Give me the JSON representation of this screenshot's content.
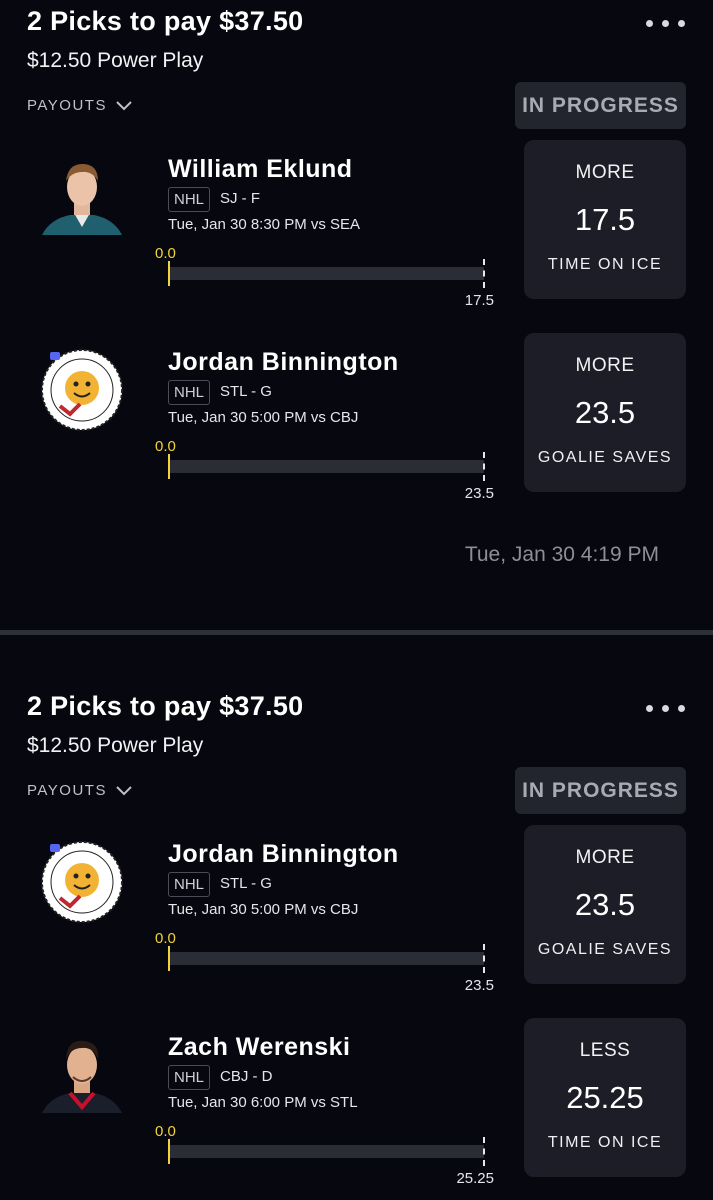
{
  "entries": [
    {
      "title": "2 Picks to pay $37.50",
      "subtitle": "$12.50 Power Play",
      "payouts_label": "PAYOUTS",
      "status": "IN PROGRESS",
      "timestamp": "Tue, Jan 30 4:19 PM",
      "picks": [
        {
          "player": "William Eklund",
          "league": "NHL",
          "team_pos": "SJ - F",
          "game": "Tue, Jan 30 8:30 PM  vs SEA",
          "current": "0.0",
          "target": "17.5",
          "direction": "MORE",
          "line": "17.5",
          "stat": "TIME ON ICE",
          "avatar": "player-headshot"
        },
        {
          "player": "Jordan Binnington",
          "league": "NHL",
          "team_pos": "STL - G",
          "game": "Tue, Jan 30 5:00 PM  vs CBJ",
          "current": "0.0",
          "target": "23.5",
          "direction": "MORE",
          "line": "23.5",
          "stat": "GOALIE SAVES",
          "avatar": "discord-voted-badge"
        }
      ]
    },
    {
      "title": "2 Picks to pay $37.50",
      "subtitle": "$12.50 Power Play",
      "payouts_label": "PAYOUTS",
      "status": "IN PROGRESS",
      "picks": [
        {
          "player": "Jordan Binnington",
          "league": "NHL",
          "team_pos": "STL - G",
          "game": "Tue, Jan 30 5:00 PM  vs CBJ",
          "current": "0.0",
          "target": "23.5",
          "direction": "MORE",
          "line": "23.5",
          "stat": "GOALIE SAVES",
          "avatar": "discord-voted-badge"
        },
        {
          "player": "Zach Werenski",
          "league": "NHL",
          "team_pos": "CBJ - D",
          "game": "Tue, Jan 30 6:00 PM  vs STL",
          "current": "0.0",
          "target": "25.25",
          "direction": "LESS",
          "line": "25.25",
          "stat": "TIME ON ICE",
          "avatar": "player-headshot"
        }
      ]
    }
  ],
  "colors": {
    "background": "#07080f",
    "progress_accent": "#f0d43a",
    "box": "#1c1d26",
    "status_bg": "#23252e"
  },
  "badge_text": {
    "top": "DISCORD VOTED",
    "bottom": "VOTED"
  }
}
